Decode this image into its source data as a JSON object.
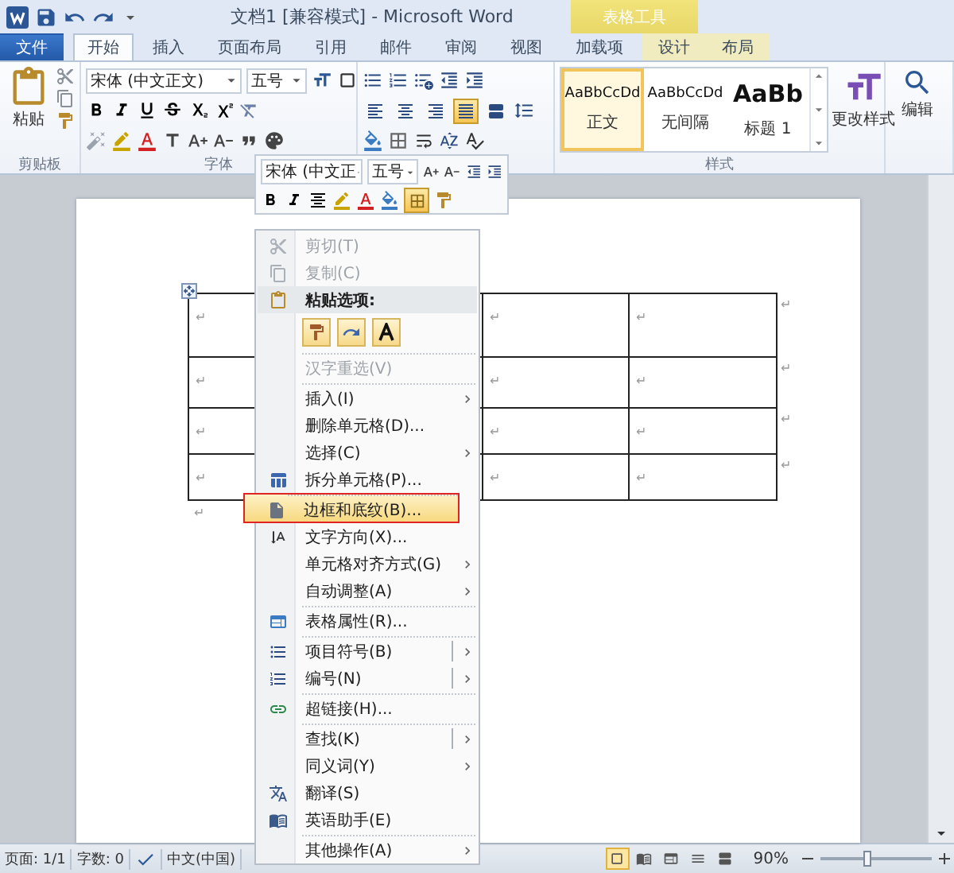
{
  "title_bar": {
    "title": "文档1 [兼容模式] - Microsoft Word",
    "context_group": "表格工具"
  },
  "tabs": [
    {
      "label": "文件",
      "kind": "file",
      "selected": false
    },
    {
      "label": "开始",
      "kind": "main",
      "selected": true
    },
    {
      "label": "插入",
      "kind": "main",
      "selected": false
    },
    {
      "label": "页面布局",
      "kind": "main",
      "selected": false
    },
    {
      "label": "引用",
      "kind": "main",
      "selected": false
    },
    {
      "label": "邮件",
      "kind": "main",
      "selected": false
    },
    {
      "label": "审阅",
      "kind": "main",
      "selected": false
    },
    {
      "label": "视图",
      "kind": "main",
      "selected": false
    },
    {
      "label": "加载项",
      "kind": "main",
      "selected": false
    },
    {
      "label": "设计",
      "kind": "context",
      "selected": false
    },
    {
      "label": "布局",
      "kind": "context",
      "selected": false
    }
  ],
  "ribbon": {
    "clipboard": {
      "paste": "粘贴",
      "label": "剪贴板"
    },
    "font": {
      "font_name": "宋体 (中文正文)",
      "font_size": "五号",
      "label": "字体"
    },
    "paragraph": {
      "alignment": [
        {
          "kind": "left",
          "selected": false
        },
        {
          "kind": "center",
          "selected": false
        },
        {
          "kind": "right",
          "selected": false
        },
        {
          "kind": "justify",
          "selected": true
        },
        {
          "kind": "distributed",
          "selected": false
        }
      ]
    },
    "styles": {
      "items": [
        {
          "preview": "AaBbCcDd",
          "name": "正文",
          "kind": "body",
          "selected": true
        },
        {
          "preview": "AaBbCcDd",
          "name": "无间隔",
          "kind": "body",
          "selected": false
        },
        {
          "preview": "AaBb",
          "name": "标题 1",
          "kind": "heading",
          "selected": false
        }
      ],
      "change_styles": "更改样式",
      "label": "样式"
    },
    "editing": {
      "label": "编辑"
    }
  },
  "mini_toolbar": {
    "font_name": "宋体 (中文正",
    "font_size": "五号",
    "borders_selected": true
  },
  "document": {
    "table": {
      "rows": [
        {
          "cells": [
            "↵",
            "↵",
            "↵"
          ],
          "end_mark": "↵"
        },
        {
          "cells": [
            "↵",
            "↵",
            "↵"
          ],
          "end_mark": "↵"
        },
        {
          "cells": [
            "↵",
            "↵",
            "↵"
          ],
          "end_mark": "↵"
        },
        {
          "cells": [
            "↵",
            "↵",
            "↵"
          ],
          "end_mark": "↵"
        }
      ]
    },
    "paragraph_mark": "↵"
  },
  "context_menu": {
    "items": [
      {
        "kind": "item",
        "label": "剪切(T)",
        "disabled": true,
        "selected": false,
        "callout": false,
        "submenu": false,
        "split": false,
        "separator_before": false
      },
      {
        "kind": "item",
        "label": "复制(C)",
        "disabled": true,
        "selected": false,
        "callout": false,
        "submenu": false,
        "split": false,
        "separator_before": false
      },
      {
        "kind": "header",
        "label": "粘贴选项:",
        "disabled": false,
        "selected": false,
        "callout": false,
        "submenu": false,
        "split": false,
        "separator_before": false
      },
      {
        "kind": "item",
        "label": "汉字重选(V)",
        "disabled": true,
        "selected": false,
        "callout": false,
        "submenu": false,
        "split": false,
        "separator_before": true
      },
      {
        "kind": "item",
        "label": "插入(I)",
        "disabled": false,
        "selected": false,
        "callout": false,
        "submenu": true,
        "split": false,
        "separator_before": true
      },
      {
        "kind": "item",
        "label": "删除单元格(D)...",
        "disabled": false,
        "selected": false,
        "callout": false,
        "submenu": false,
        "split": false,
        "separator_before": false
      },
      {
        "kind": "item",
        "label": "选择(C)",
        "disabled": false,
        "selected": false,
        "callout": false,
        "submenu": true,
        "split": false,
        "separator_before": false
      },
      {
        "kind": "item",
        "label": "拆分单元格(P)...",
        "disabled": false,
        "selected": false,
        "callout": false,
        "submenu": false,
        "split": false,
        "separator_before": false
      },
      {
        "kind": "item",
        "label": "边框和底纹(B)...",
        "disabled": false,
        "selected": true,
        "callout": true,
        "submenu": false,
        "split": false,
        "separator_before": true
      },
      {
        "kind": "item",
        "label": "文字方向(X)...",
        "disabled": false,
        "selected": false,
        "callout": false,
        "submenu": false,
        "split": false,
        "separator_before": false
      },
      {
        "kind": "item",
        "label": "单元格对齐方式(G)",
        "disabled": false,
        "selected": false,
        "callout": false,
        "submenu": true,
        "split": false,
        "separator_before": false
      },
      {
        "kind": "item",
        "label": "自动调整(A)",
        "disabled": false,
        "selected": false,
        "callout": false,
        "submenu": true,
        "split": false,
        "separator_before": false
      },
      {
        "kind": "item",
        "label": "表格属性(R)...",
        "disabled": false,
        "selected": false,
        "callout": false,
        "submenu": false,
        "split": false,
        "separator_before": true
      },
      {
        "kind": "item",
        "label": "项目符号(B)",
        "disabled": false,
        "selected": false,
        "callout": false,
        "submenu": true,
        "split": true,
        "separator_before": true
      },
      {
        "kind": "item",
        "label": "编号(N)",
        "disabled": false,
        "selected": false,
        "callout": false,
        "submenu": true,
        "split": true,
        "separator_before": false
      },
      {
        "kind": "item",
        "label": "超链接(H)...",
        "disabled": false,
        "selected": false,
        "callout": false,
        "submenu": false,
        "split": false,
        "separator_before": true
      },
      {
        "kind": "item",
        "label": "查找(K)",
        "disabled": false,
        "selected": false,
        "callout": false,
        "submenu": true,
        "split": true,
        "separator_before": true
      },
      {
        "kind": "item",
        "label": "同义词(Y)",
        "disabled": false,
        "selected": false,
        "callout": false,
        "submenu": true,
        "split": false,
        "separator_before": false
      },
      {
        "kind": "item",
        "label": "翻译(S)",
        "disabled": false,
        "selected": false,
        "callout": false,
        "submenu": false,
        "split": false,
        "separator_before": false
      },
      {
        "kind": "item",
        "label": "英语助手(E)",
        "disabled": false,
        "selected": false,
        "callout": false,
        "submenu": false,
        "split": false,
        "separator_before": false
      },
      {
        "kind": "item",
        "label": "其他操作(A)",
        "disabled": false,
        "selected": false,
        "callout": false,
        "submenu": true,
        "split": false,
        "separator_before": true
      }
    ]
  },
  "status_bar": {
    "page": "页面: 1/1",
    "words": "字数: 0",
    "language": "中文(中国)",
    "views": [
      {
        "kind": "print",
        "selected": true
      },
      {
        "kind": "reading",
        "selected": false
      },
      {
        "kind": "web",
        "selected": false
      },
      {
        "kind": "outline",
        "selected": false
      },
      {
        "kind": "draft",
        "selected": false
      }
    ],
    "zoom": "90%",
    "zoom_slider": {
      "level": 0.42
    }
  }
}
